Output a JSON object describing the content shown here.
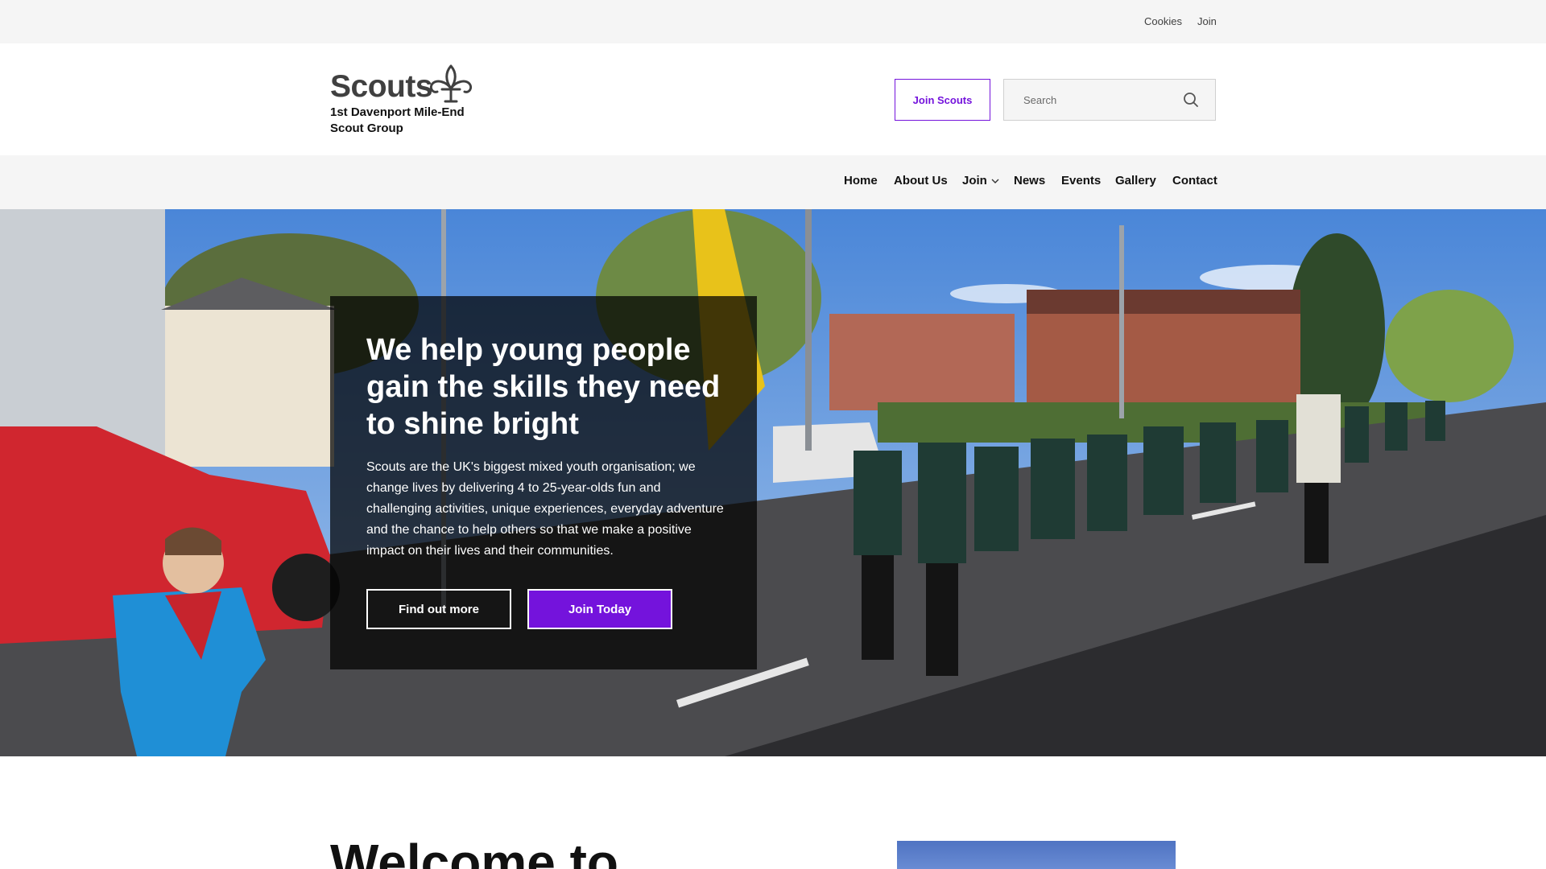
{
  "utility": {
    "cookies": "Cookies",
    "join": "Join"
  },
  "header": {
    "logo_text": "Scouts",
    "group_name": "1st Davenport Mile-End Scout Group",
    "join_button": "Join Scouts",
    "search_placeholder": "Search"
  },
  "nav": {
    "items": [
      "Home",
      "About Us",
      "Join",
      "News",
      "Events",
      "Gallery",
      "Contact"
    ]
  },
  "hero": {
    "heading": "We help young people gain the skills they need to shine bright",
    "text": "Scouts are the UK's biggest mixed youth organisation; we change lives by delivering 4 to 25-year-olds fun and challenging activities, unique experiences, everyday adventure and the chance to help others so that we make a positive impact on their lives and their communities.",
    "primary_button": "Find out more",
    "secondary_button": "Join Today"
  },
  "welcome": {
    "heading": "Welcome to"
  },
  "colors": {
    "brand_purple": "#7413dc",
    "utility_bg": "#f5f5f5",
    "panel_bg": "rgba(0,0,0,0.72)"
  },
  "icons": {
    "logo": "fleur-de-lis-icon",
    "search": "search-icon",
    "join_dropdown": "chevron-down-icon"
  }
}
